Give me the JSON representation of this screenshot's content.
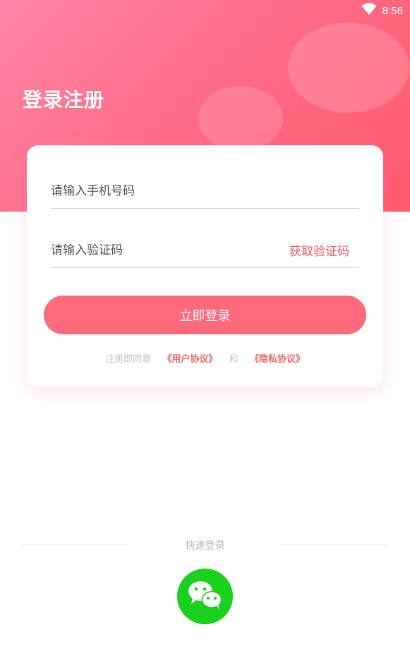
{
  "status_bar": {
    "time": "8:56",
    "wifi_icon": "wifi-icon"
  },
  "header": {
    "title": "登录注册"
  },
  "form": {
    "phone_placeholder": "请输入手机号码",
    "code_placeholder": "请输入验证码",
    "get_code_label": "获取验证码",
    "login_label": "立即登录"
  },
  "agreement": {
    "prefix": "注册即同意",
    "user_agreement": "《用户协议》",
    "conjunction": "和",
    "privacy_policy": "《隐私协议》"
  },
  "quick_login": {
    "label": "快速登录",
    "wechat_icon": "wechat-icon"
  },
  "colors": {
    "accent": "#ff6b7b",
    "link": "#f26b6b",
    "wechat": "#1ad11d",
    "header_gradient_start": "#ff86a9",
    "header_gradient_end": "#ff5a6e"
  }
}
